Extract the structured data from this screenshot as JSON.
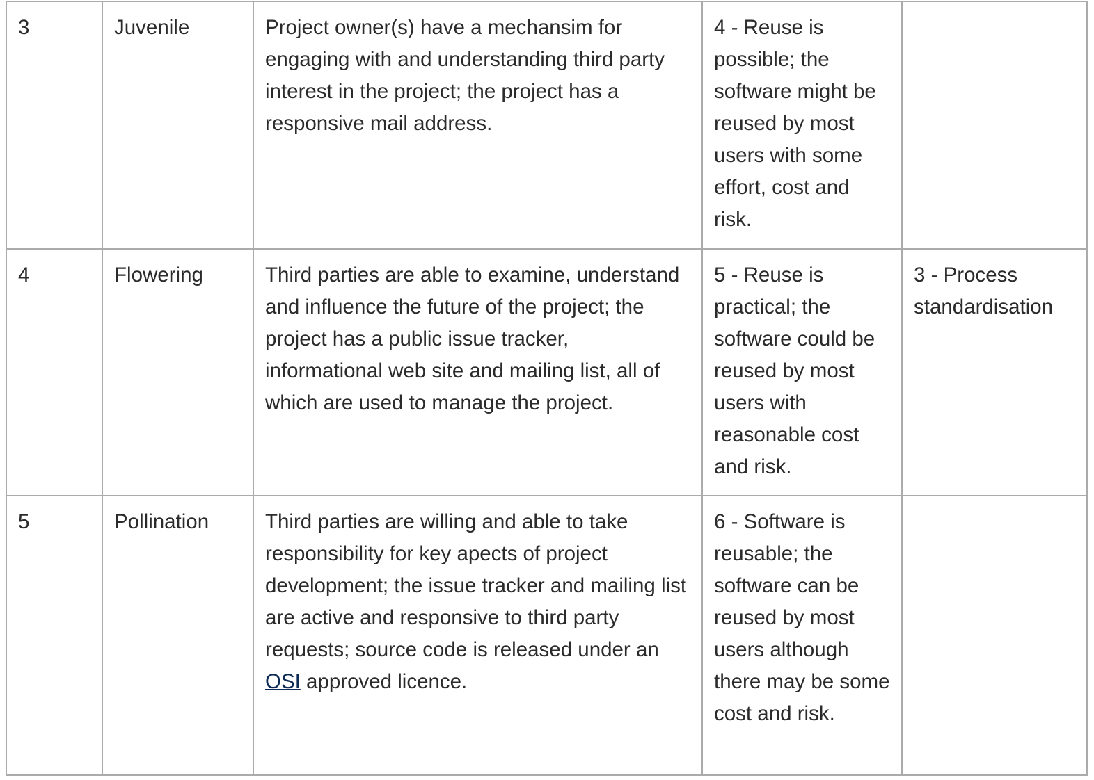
{
  "rows": [
    {
      "level": "3",
      "name": "Juvenile",
      "description": "Project owner(s) have a mechansim for engaging with and understanding third party interest in the project; the project has a responsive mail address.",
      "reuse": "4 - Reuse is possible; the software might be reused by most users with some effort, cost and risk.",
      "process": ""
    },
    {
      "level": "4",
      "name": "Flowering",
      "description": "Third parties are able to examine, understand and influence the future of the project; the project has a public issue tracker, informational web site and mailing list, all of which are used to manage the project.",
      "reuse": "5 - Reuse is practical; the software could be reused by most users with reasonable cost and risk.",
      "process": "3 - Process standardisation"
    },
    {
      "level": "5",
      "name": "Pollination",
      "description_before_link": "Third parties are willing and able to take responsibility for key apects of project development; the issue tracker and mailing list are active and responsive to third party requests; source code is released under an ",
      "description_link": "OSI",
      "description_after_link": " approved licence.",
      "reuse": "6 - Software is reusable; the software can be reused by most users although there may be some cost and risk.",
      "process": ""
    }
  ],
  "colors": {
    "link": "#0b2a55",
    "border": "#ababab",
    "text": "#2b2b2b"
  }
}
